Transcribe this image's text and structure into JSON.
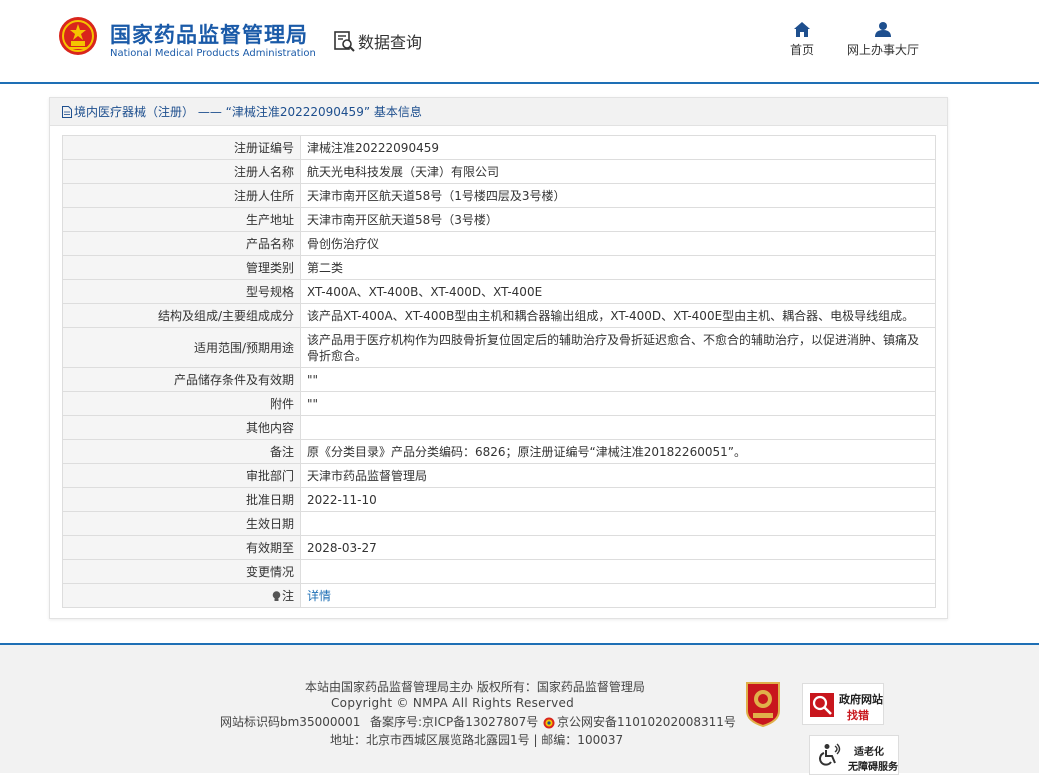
{
  "header": {
    "site_title": "国家药品监督管理局",
    "site_subtitle": "National Medical Products Administration",
    "query_label": "数据查询",
    "nav": {
      "home": "首页",
      "hall": "网上办事大厅"
    },
    "colors": {
      "brand": "#1a5aa8",
      "accent": "#1e6fb5"
    }
  },
  "panel": {
    "title": "境内医疗器械（注册） ——  “津械注准20222090459” 基本信息"
  },
  "record": [
    {
      "key": "注册证编号",
      "value": "津械注准20222090459"
    },
    {
      "key": "注册人名称",
      "value": "航天光电科技发展（天津）有限公司"
    },
    {
      "key": "注册人住所",
      "value": "天津市南开区航天道58号（1号楼四层及3号楼）"
    },
    {
      "key": "生产地址",
      "value": "天津市南开区航天道58号（3号楼）"
    },
    {
      "key": "产品名称",
      "value": "骨创伤治疗仪"
    },
    {
      "key": "管理类别",
      "value": "第二类"
    },
    {
      "key": "型号规格",
      "value": "XT-400A、XT-400B、XT-400D、XT-400E"
    },
    {
      "key": "结构及组成/主要组成成分",
      "value": "该产品XT-400A、XT-400B型由主机和耦合器输出组成，XT-400D、XT-400E型由主机、耦合器、电极导线组成。"
    },
    {
      "key": "适用范围/预期用途",
      "value": "该产品用于医疗机构作为四肢骨折复位固定后的辅助治疗及骨折延迟愈合、不愈合的辅助治疗，以促进消肿、镇痛及骨折愈合。"
    },
    {
      "key": "产品储存条件及有效期",
      "value": "\"\""
    },
    {
      "key": "附件",
      "value": "\"\""
    },
    {
      "key": "其他内容",
      "value": ""
    },
    {
      "key": "备注",
      "value": "原《分类目录》产品分类编码：6826；原注册证编号“津械注准20182260051”。"
    },
    {
      "key": "审批部门",
      "value": "天津市药品监督管理局"
    },
    {
      "key": "批准日期",
      "value": "2022-11-10"
    },
    {
      "key": "生效日期",
      "value": ""
    },
    {
      "key": "有效期至",
      "value": "2028-03-27"
    },
    {
      "key": "变更情况",
      "value": ""
    },
    {
      "key": "注",
      "value": "详情"
    }
  ],
  "footer": {
    "line1": "本站由国家药品监督管理局主办 版权所有：国家药品监督管理局",
    "line2": "Copyright © NMPA All Rights Reserved",
    "site_id": "网站标识码bm35000001",
    "icp": "备案序号:京ICP备13027807号",
    "police": "京公网安备11010202008311号",
    "address": "地址：北京市西城区展览路北露园1号 | 邮编：100037",
    "gov_badge": {
      "line1": "政府网站",
      "line2": "找错"
    },
    "access_badge": {
      "line1": "适老化",
      "line2": "无障碍服务"
    }
  }
}
